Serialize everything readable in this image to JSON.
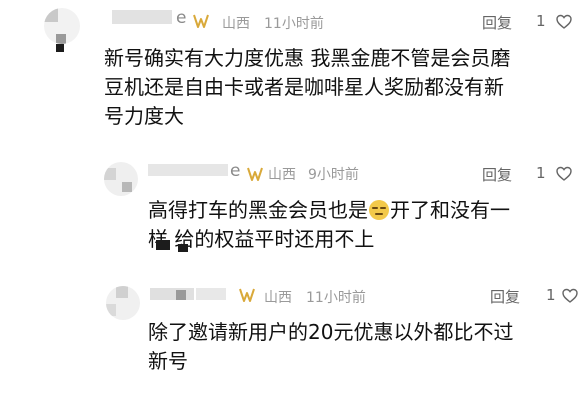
{
  "comments": [
    {
      "name": "e",
      "location": "山西",
      "time": "11小时前",
      "reply_label": "回复",
      "likes": "1",
      "lines": [
        "新号确实有大力度优惠 我黑金鹿不管是会员磨",
        "豆机还是自由卡或者是咖啡星人奖励都没有新",
        "号力度大"
      ]
    },
    {
      "name": "e",
      "location": "山西",
      "time": "9小时前",
      "reply_label": "回复",
      "likes": "1",
      "line1_a": "高得打车的黑金会员也是",
      "line1_b": "开了和没有一",
      "line2": "样 给的权益平时还用不上"
    },
    {
      "name": "",
      "location": "山西",
      "time": "11小时前",
      "reply_label": "回复",
      "likes": "1",
      "lines": [
        "除了邀请新用户的20元优惠以外都比不过",
        "新号"
      ]
    }
  ],
  "colors": {
    "badge": "#d9a93a",
    "meta": "#9a9a9a",
    "text": "#111111"
  }
}
